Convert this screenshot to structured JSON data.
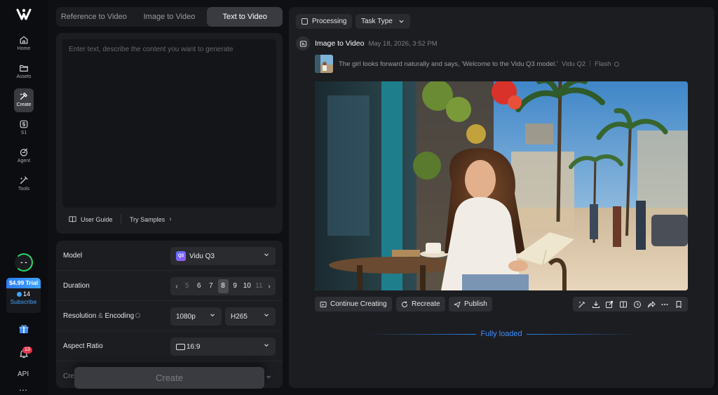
{
  "sidebar": {
    "logo": "vidu-logo",
    "items": [
      {
        "label": "Home",
        "icon": "home-icon"
      },
      {
        "label": "Assets",
        "icon": "folder-icon"
      },
      {
        "label": "Create",
        "icon": "create-icon",
        "active": true
      },
      {
        "label": "S1",
        "icon": "s1-icon"
      },
      {
        "label": "Agent",
        "icon": "agent-icon"
      },
      {
        "label": "Tools",
        "icon": "tools-icon"
      }
    ],
    "avatar_text": "- -",
    "trial": {
      "price": "$4.99 Trial",
      "credits": "14",
      "subscribe": "Subscribe"
    },
    "notification_count": "13",
    "api_label": "API",
    "more": "⋯"
  },
  "left": {
    "tabs": [
      {
        "label": "Reference to Video"
      },
      {
        "label": "Image to Video"
      },
      {
        "label": "Text to Video",
        "active": true
      }
    ],
    "prompt_placeholder": "Enter text, describe the content you want to generate",
    "user_guide": "User Guide",
    "try_samples": "Try Samples",
    "settings": {
      "model_label": "Model",
      "model_value": "Vidu Q3",
      "model_badge": "Q3",
      "duration_label": "Duration",
      "durations": [
        "5",
        "6",
        "7",
        "8",
        "9",
        "10",
        "11"
      ],
      "duration_selected": "8",
      "resolution_label_a": "Resolution",
      "resolution_label_amp": "&",
      "resolution_label_b": "Encoding",
      "resolution_value": "1080p",
      "encoding_value": "H265",
      "aspect_label": "Aspect Ratio",
      "aspect_value": "16:9",
      "partial_label": "Cre"
    },
    "create_button": "Create"
  },
  "right": {
    "filters": {
      "processing": "Processing",
      "task_type": "Task Type"
    },
    "task": {
      "title": "Image to Video",
      "time": "May 18, 2026, 3:52 PM",
      "prompt": "The girl looks forward naturally and says, 'Welcome to the Vidu Q3 model.'",
      "model": "Vidu Q2",
      "mode": "Flash"
    },
    "actions": {
      "continue": "Continue Creating",
      "recreate": "Recreate",
      "publish": "Publish"
    },
    "icon_bar": [
      "magic-wand-icon",
      "download-icon",
      "share-out-icon",
      "extend-icon",
      "history-icon",
      "forward-icon",
      "more-icon",
      "bookmark-icon"
    ],
    "footer": "Fully loaded"
  }
}
